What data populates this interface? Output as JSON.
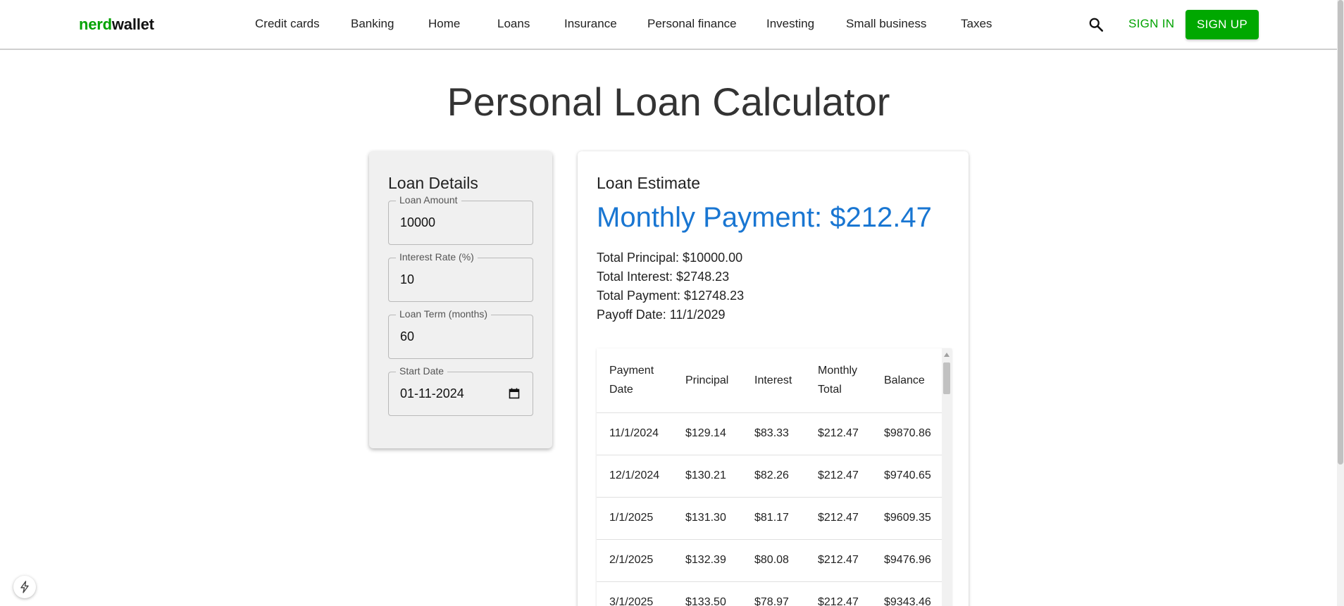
{
  "brand": {
    "part1": "nerd",
    "part2": "wallet"
  },
  "nav": [
    "Credit cards",
    "Banking",
    "Home",
    "Loans",
    "Insurance",
    "Personal finance",
    "Investing",
    "Small business",
    "Taxes"
  ],
  "auth": {
    "sign_in": "SIGN IN",
    "sign_up": "SIGN UP"
  },
  "page_title": "Personal Loan Calculator",
  "details": {
    "heading": "Loan Details",
    "fields": [
      {
        "label": "Loan Amount",
        "value": "10000"
      },
      {
        "label": "Interest Rate (%)",
        "value": "10"
      },
      {
        "label": "Loan Term (months)",
        "value": "60"
      },
      {
        "label": "Start Date",
        "value": "01-11-2024"
      }
    ]
  },
  "estimate": {
    "heading": "Loan Estimate",
    "monthly_payment": "Monthly Payment: $212.47",
    "summary": [
      "Total Principal: $10000.00",
      "Total Interest: $2748.23",
      "Total Payment: $12748.23",
      "Payoff Date: 11/1/2029"
    ]
  },
  "schedule": {
    "headers": [
      "Payment Date",
      "Principal",
      "Interest",
      "Monthly Total",
      "Balance"
    ],
    "rows": [
      [
        "11/1/2024",
        "$129.14",
        "$83.33",
        "$212.47",
        "$9870.86"
      ],
      [
        "12/1/2024",
        "$130.21",
        "$82.26",
        "$212.47",
        "$9740.65"
      ],
      [
        "1/1/2025",
        "$131.30",
        "$81.17",
        "$212.47",
        "$9609.35"
      ],
      [
        "2/1/2025",
        "$132.39",
        "$80.08",
        "$212.47",
        "$9476.96"
      ],
      [
        "3/1/2025",
        "$133.50",
        "$78.97",
        "$212.47",
        "$9343.46"
      ]
    ]
  },
  "colors": {
    "brand_green": "#00a300",
    "accent_blue": "#1976d2"
  }
}
